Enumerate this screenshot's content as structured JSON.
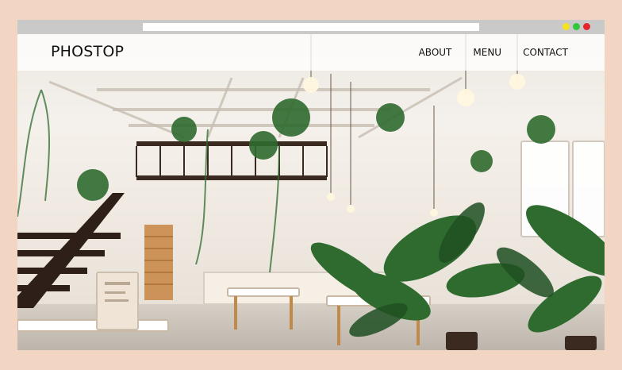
{
  "browser": {
    "dots": [
      {
        "name": "minimize-dot",
        "color": "#f4e21f"
      },
      {
        "name": "maximize-dot",
        "color": "#32c63b"
      },
      {
        "name": "close-dot",
        "color": "#e3242b"
      }
    ]
  },
  "site": {
    "brand": "PHOSTOP",
    "nav": [
      {
        "label": "ABOUT"
      },
      {
        "label": "MENU"
      },
      {
        "label": "CONTACT"
      }
    ]
  },
  "hero": {
    "image_subject": "bright cafe interior with hanging plants"
  }
}
